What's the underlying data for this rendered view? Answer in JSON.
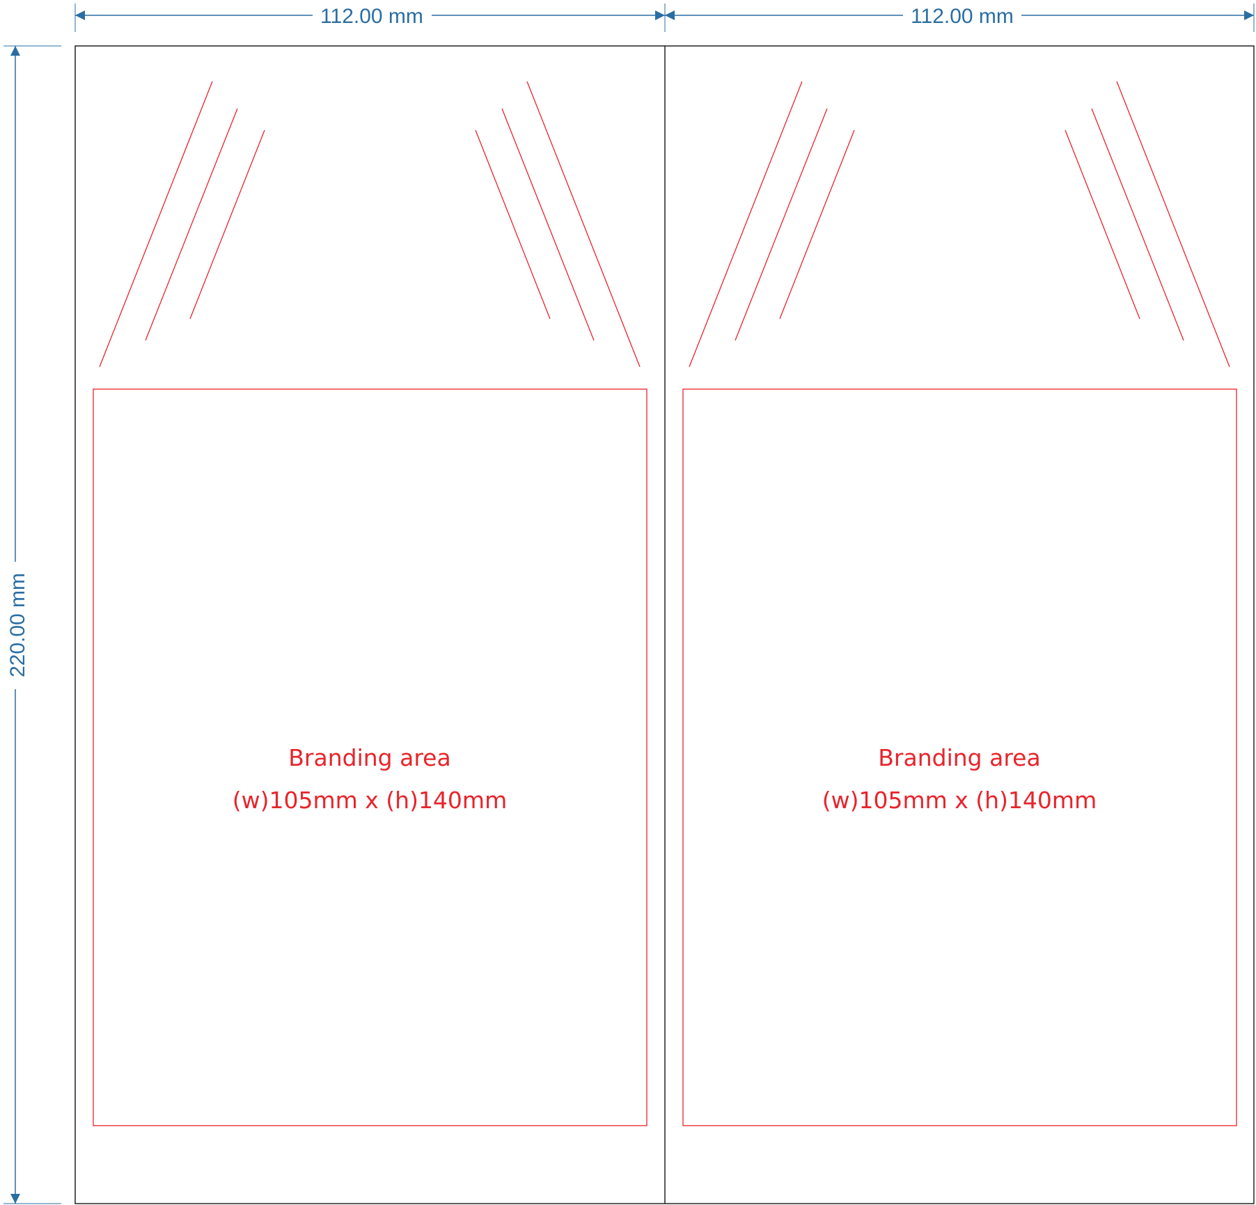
{
  "colors": {
    "dimension": "#2a6da3",
    "outline": "#222222",
    "print_guide": "#e8242b"
  },
  "dimensions": {
    "left_width": "112.00 mm",
    "right_width": "112.00 mm",
    "height": "220.00 mm"
  },
  "panels": [
    {
      "branding_title": "Branding area",
      "branding_size": "(w)105mm x (h)140mm"
    },
    {
      "branding_title": "Branding area",
      "branding_size": "(w)105mm x (h)140mm"
    }
  ]
}
